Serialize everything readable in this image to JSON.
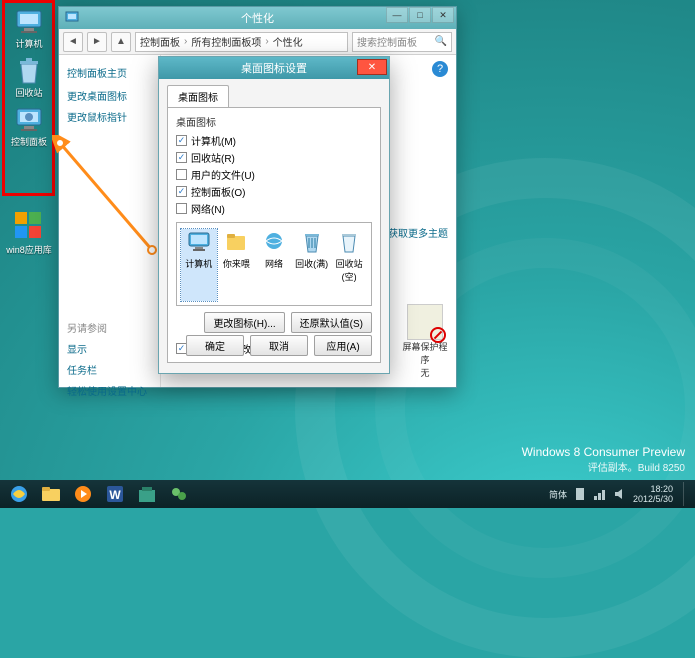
{
  "desktop_icons": [
    {
      "name": "computer-icon",
      "label": "计算机"
    },
    {
      "name": "recycle-bin-icon",
      "label": "回收站"
    },
    {
      "name": "control-panel-icon",
      "label": "控制面板"
    }
  ],
  "extra_desktop_icon": {
    "name": "win8-app-icon",
    "label": "win8应用库"
  },
  "personalization_window": {
    "title": "个性化",
    "breadcrumb": {
      "root": "控制面板",
      "mid": "所有控制面板项",
      "leaf": "个性化"
    },
    "search_placeholder": "搜索控制面板",
    "left_nav": {
      "home": "控制面板主页",
      "links": [
        "更改桌面图标",
        "更改鼠标指针"
      ],
      "see_also_header": "另请参阅",
      "see_also": [
        "显示",
        "任务栏",
        "轻松使用设置中心"
      ]
    },
    "online_themes_link": "联机获取更多主题",
    "screensaver": {
      "label": "屏幕保护程序",
      "value": "无"
    }
  },
  "dialog": {
    "title": "桌面图标设置",
    "tab": "桌面图标",
    "group_label": "桌面图标",
    "checkboxes": [
      {
        "label": "计算机(M)",
        "checked": true
      },
      {
        "label": "回收站(R)",
        "checked": true
      },
      {
        "label": "用户的文件(U)",
        "checked": false
      },
      {
        "label": "控制面板(O)",
        "checked": true
      },
      {
        "label": "网络(N)",
        "checked": false
      }
    ],
    "icon_list": [
      "计算机",
      "你来喂",
      "网络",
      "回收(满)",
      "回收站(空)"
    ],
    "change_icon_btn": "更改图标(H)...",
    "restore_btn": "还原默认值(S)",
    "allow_theme_label": "允许主题更改桌面图标(L)",
    "allow_theme_checked": true,
    "ok": "确定",
    "cancel": "取消",
    "apply": "应用(A)"
  },
  "watermark": {
    "line1": "Windows 8 Consumer Preview",
    "line2": "评估副本。Build 8250"
  },
  "taskbar": {
    "buttons": [
      "ie-icon",
      "explorer-icon",
      "media-player-icon",
      "word-icon",
      "store-icon",
      "messenger-icon"
    ],
    "ime": "简体",
    "clock": {
      "time": "18:20",
      "date": "2012/5/30"
    }
  }
}
